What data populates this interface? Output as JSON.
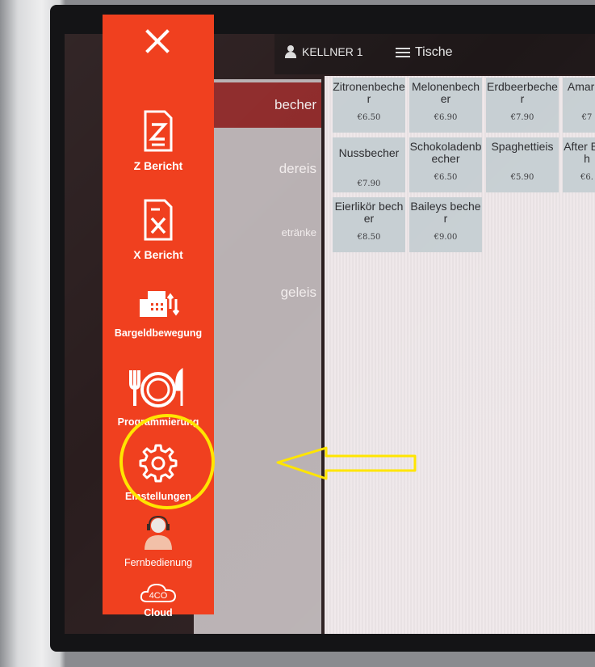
{
  "topbar": {
    "waiter_label": "KELLNER 1",
    "tables_label": "Tische"
  },
  "categories": [
    {
      "label": "becher",
      "active": true
    },
    {
      "label": "dereis",
      "active": false
    },
    {
      "label": "etränke",
      "active": false
    },
    {
      "label": "geleis",
      "active": false
    }
  ],
  "products": [
    {
      "name": "Zitronenbecher",
      "price": "€6.50"
    },
    {
      "name": "Melonenbecher",
      "price": "€6.90"
    },
    {
      "name": "Erdbeerbecher",
      "price": "€7.90"
    },
    {
      "name": "Amarch",
      "price": "€7"
    },
    {
      "name": "Nussbecher",
      "price": "€7.90"
    },
    {
      "name": "Schokoladenbecher",
      "price": "€6.50"
    },
    {
      "name": "Spaghettieis",
      "price": "€5.90"
    },
    {
      "name": "After Bech",
      "price": "€6."
    },
    {
      "name": "Eierlikör becher",
      "price": "€8.50"
    },
    {
      "name": "Baileys becher",
      "price": "€9.00"
    }
  ],
  "menu": {
    "items": [
      {
        "label": "Z Bericht",
        "icon": "z-report-icon"
      },
      {
        "label": "X Bericht",
        "icon": "x-report-icon"
      },
      {
        "label": "Bargeldbewegung",
        "icon": "cash-register-icon"
      },
      {
        "label": "Programmierung",
        "icon": "plate-cutlery-icon"
      },
      {
        "label": "Einstellungen",
        "icon": "gear-icon"
      },
      {
        "label": "Fernbedienung",
        "icon": "support-agent-icon"
      },
      {
        "label": "Cloud",
        "icon": "cloud-icon",
        "icon_text": "4CO"
      }
    ]
  },
  "colors": {
    "menu_bg": "#f0401f",
    "highlight": "#ffe500",
    "tile_bg": "#c7cfd3",
    "active_category": "#8e2a2a"
  }
}
